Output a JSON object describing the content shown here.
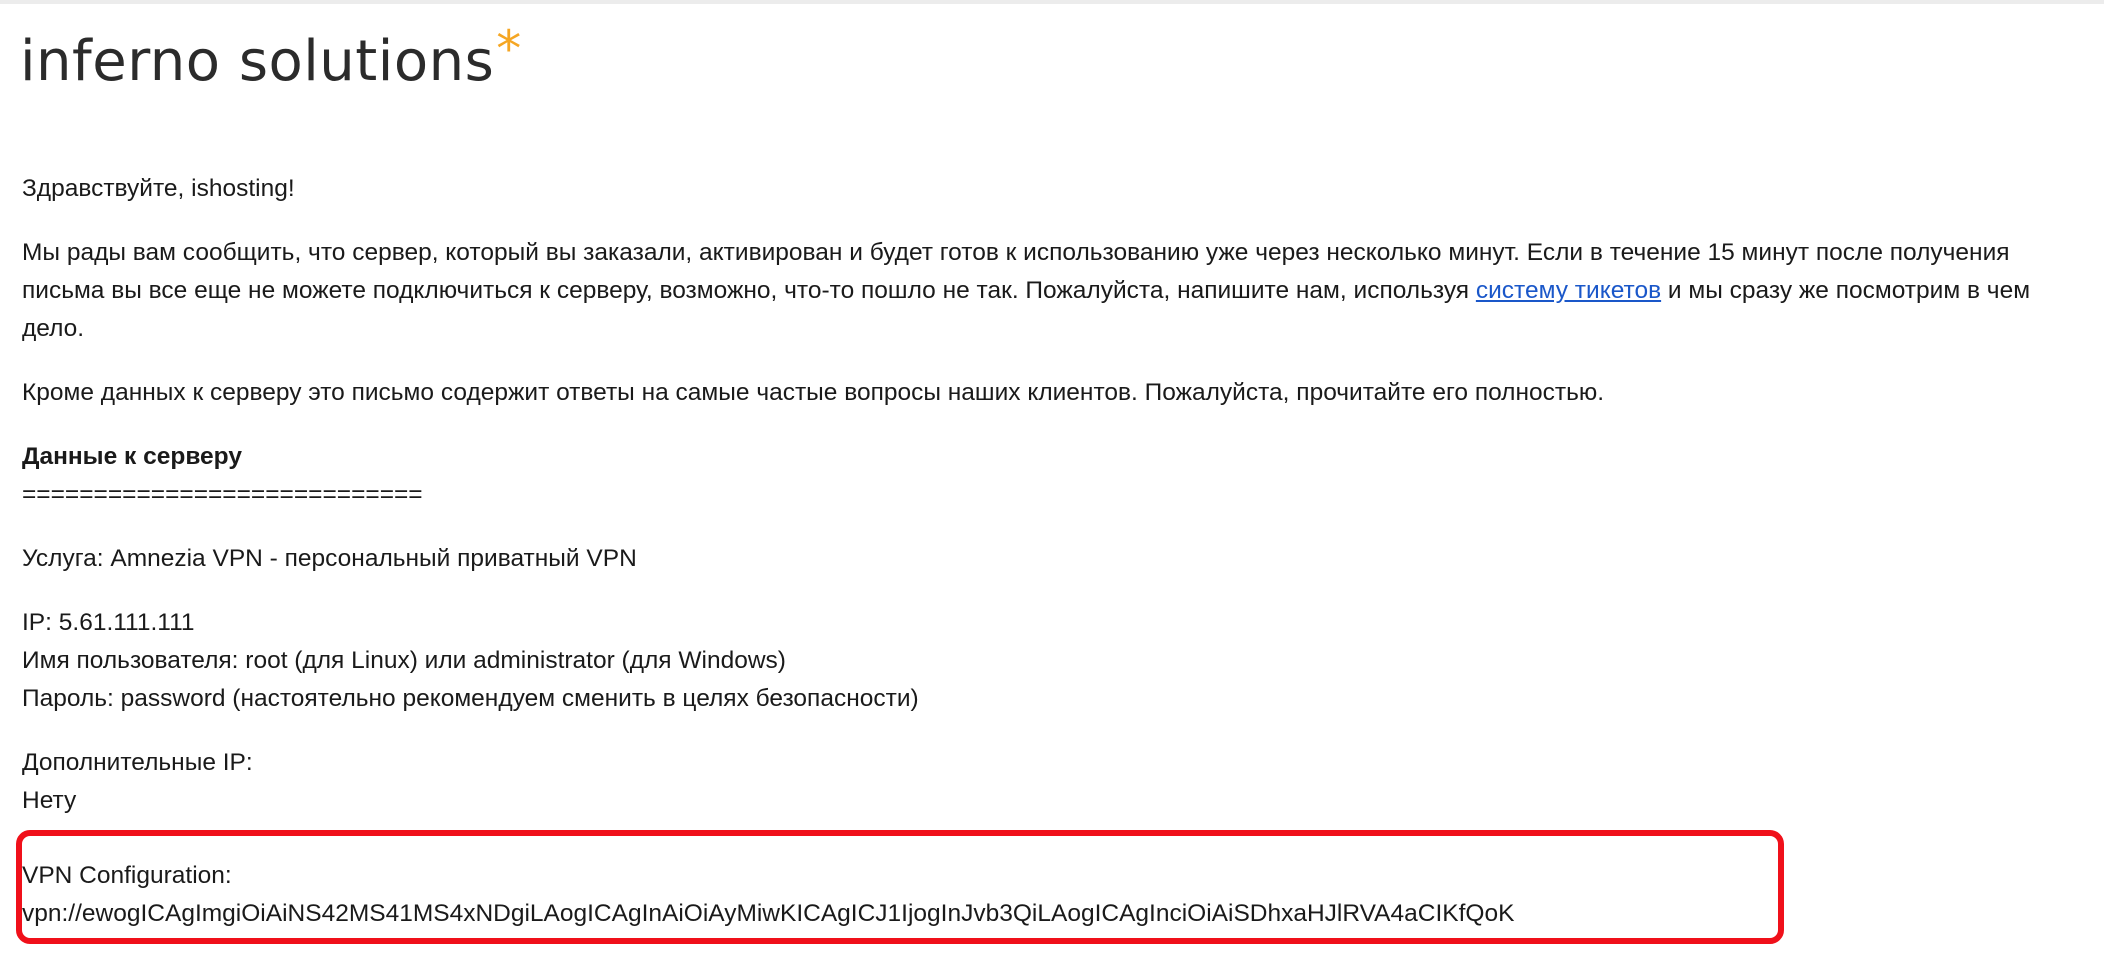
{
  "logo": {
    "text": "inferno solutions",
    "star": "*"
  },
  "email": {
    "greeting": "Здравствуйте, ishosting!",
    "para1_before_link": "Мы рады вам сообщить, что сервер, который вы заказали, активирован и будет готов к использованию уже через несколько минут. Если в течение 15 минут после получения письма вы все еще не можете подключиться к серверу, возможно, что-то пошло не так. Пожалуйста, напишите нам, используя ",
    "para1_link": "систему тикетов",
    "para1_after_link": " и мы сразу же посмотрим в чем дело.",
    "para2": "Кроме данных к серверу это письмо содержит ответы на самые частые вопросы наших клиентов. Пожалуйста, прочитайте его полностью.",
    "server_heading": "Данные к серверу",
    "separator": "============================",
    "service": "Услуга: Amnezia VPN - персональный приватный VPN",
    "ip": "IP: 5.61.111.111",
    "username": "Имя пользователя: root (для Linux) или administrator (для Windows)",
    "password": "Пароль: password (настоятельно рекомендуем сменить в целях безопасности)",
    "extra_ip_label": "Дополнительные IP:",
    "extra_ip_value": "Нету",
    "vpn_label": "VPN Configuration:",
    "vpn_value": "vpn://ewogICAgImgiOiAiNS42MS41MS4xNDgiLAogICAgInAiOiAyMiwKICAgICJ1IjogInJvb3QiLAogICAgInciOiAiSDhxaHJlRVA4aCIKfQoK"
  },
  "colors": {
    "highlight_border": "#f0101a",
    "logo_star": "#f5a623",
    "link": "#1a57c9"
  }
}
